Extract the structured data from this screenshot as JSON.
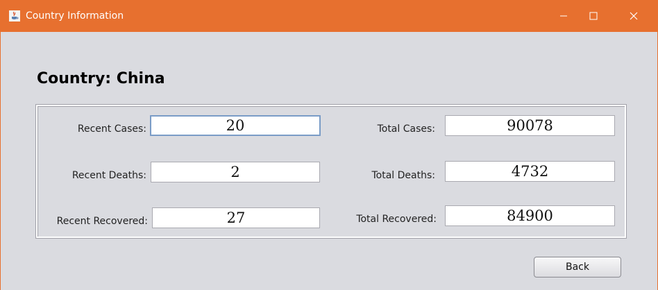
{
  "window": {
    "title": "Country Information",
    "icon": "java-cup-icon",
    "accent_color": "#e7702f"
  },
  "heading": "Country: China",
  "stats": {
    "recent_cases": {
      "label": "Recent Cases:",
      "value": "20"
    },
    "recent_deaths": {
      "label": "Recent Deaths:",
      "value": "2"
    },
    "recent_recovered": {
      "label": "Recent Recovered:",
      "value": "27"
    },
    "total_cases": {
      "label": "Total Cases:",
      "value": "90078"
    },
    "total_deaths": {
      "label": "Total Deaths:",
      "value": "4732"
    },
    "total_recovered": {
      "label": "Total Recovered:",
      "value": "84900"
    }
  },
  "back_label": "Back"
}
